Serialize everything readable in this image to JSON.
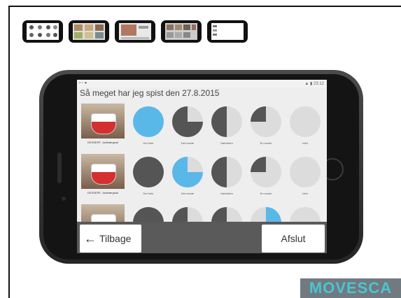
{
  "app": {
    "title": "Så meget har jeg spist den 27.8.2015",
    "status_time": "23:12"
  },
  "thumbnails": [
    "thumb-1",
    "thumb-2",
    "thumb-3",
    "thumb-4",
    "thumb-5"
  ],
  "rows": [
    {
      "food_label": "DESSERT: Jordbærgrød",
      "options": [
        "Det hele",
        "Det meste",
        "Halvdelen",
        "En smule",
        "Intet"
      ],
      "selected": "Det hele"
    },
    {
      "food_label": "DESSERT: Jordbærgrød",
      "options": [
        "Det hele",
        "Det meste",
        "Halvdelen",
        "En smule",
        "Intet"
      ],
      "selected": "Det meste"
    }
  ],
  "buttons": {
    "back": "Tilbage",
    "finish": "Afslut"
  },
  "logo": "MOVESCA",
  "colors": {
    "selected": "#5ab8e8",
    "dark": "#555555",
    "light": "#dcdcdc"
  }
}
